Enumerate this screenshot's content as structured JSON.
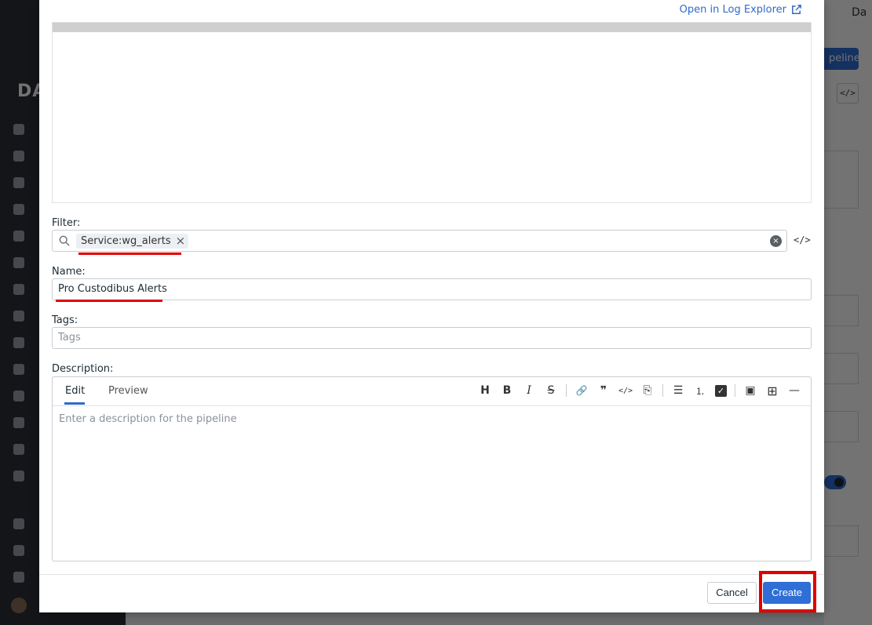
{
  "modal": {
    "open_in_log_explorer": "Open in Log Explorer",
    "filter": {
      "label": "Filter:",
      "chip_text": "Service:wg_alerts",
      "chip_remove": "×",
      "clear": "×",
      "code_toggle": "</>"
    },
    "name": {
      "label": "Name:",
      "value": "Pro Custodibus Alerts"
    },
    "tags": {
      "label": "Tags:",
      "placeholder": "Tags"
    },
    "description": {
      "label": "Description:",
      "tabs": [
        "Edit",
        "Preview"
      ],
      "active_tab": "Edit",
      "placeholder": "Enter a description for the pipeline",
      "toolbar": {
        "heading": "H",
        "bold": "B",
        "italic": "I",
        "strike": "S",
        "link": "🔗",
        "quote": "❞",
        "code": "</>",
        "code_block": "⎘",
        "bullet_list": "☰",
        "numbered_list": "⒈",
        "task_list": "✓",
        "image": "▣",
        "table": "⊞",
        "rule": "—"
      }
    },
    "footer": {
      "cancel": "Cancel",
      "create": "Create"
    }
  },
  "background": {
    "logo": "DA",
    "top_right": "Da",
    "pipeline_button": "peline",
    "code_button": "</>"
  },
  "colors": {
    "accent": "#2e6ed6",
    "annotation": "#e00000",
    "link": "#2f6bc9"
  }
}
